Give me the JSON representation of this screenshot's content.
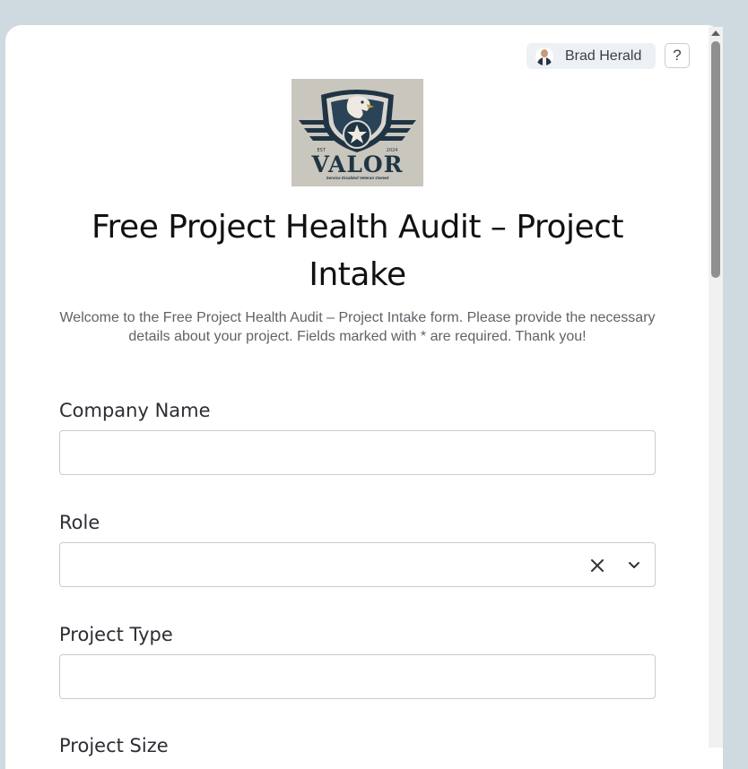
{
  "header": {
    "user_name": "Brad Herald",
    "help_label": "?"
  },
  "logo": {
    "brand": "VALOR",
    "tagline": "Service Disabled Veteran Owned",
    "est": "EST",
    "year": "2024"
  },
  "form": {
    "title": "Free Project Health Audit – Project Intake",
    "description": "Welcome to the Free Project Health Audit – Project Intake form. Please provide the necessary details about your project. Fields marked with * are required. Thank you!",
    "fields": [
      {
        "label": "Company Name",
        "value": "",
        "type": "text"
      },
      {
        "label": "Role",
        "value": "",
        "type": "select"
      },
      {
        "label": "Project Type",
        "value": "",
        "type": "text"
      },
      {
        "label": "Project Size",
        "value": "",
        "type": "text"
      }
    ]
  },
  "colors": {
    "background": "#cfd9e0",
    "card": "#ffffff",
    "logo_navy": "#1f3444",
    "logo_bg": "#c9c6bd"
  }
}
